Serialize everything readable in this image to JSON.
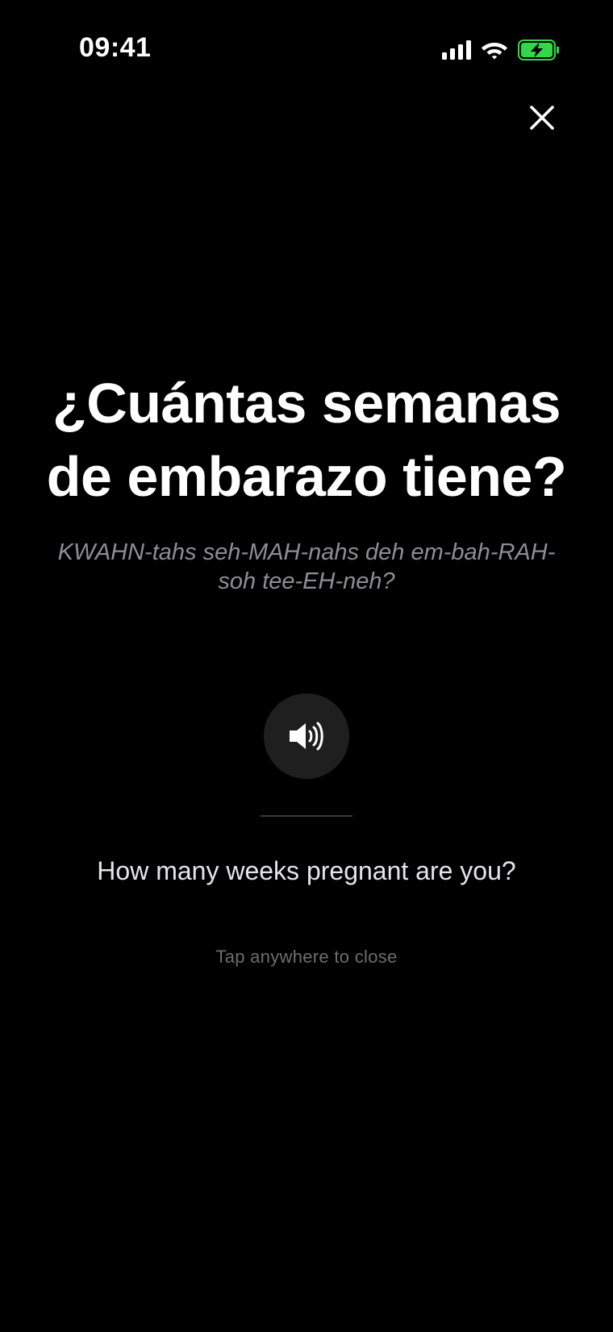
{
  "status_bar": {
    "time": "09:41",
    "icons": [
      "cellular-signal-icon",
      "wifi-icon",
      "battery-charging-icon"
    ],
    "battery_color": "#32d74b"
  },
  "header": {
    "close_icon": "close-icon"
  },
  "phrase": {
    "spanish": "¿Cuántas semanas de embarazo tiene?",
    "pronunciation": "KWAHN-tahs seh-MAH-nahs deh em-bah-RAH-soh tee-EH-neh?",
    "english": "How many weeks pregnant are you?",
    "audio_icon": "speaker-volume-icon"
  },
  "footer": {
    "hint": "Tap anywhere to close"
  },
  "colors": {
    "background": "#000000",
    "primary_text": "#ffffff",
    "secondary_text": "#8e8e93",
    "button_bg": "#1f1f1f"
  }
}
